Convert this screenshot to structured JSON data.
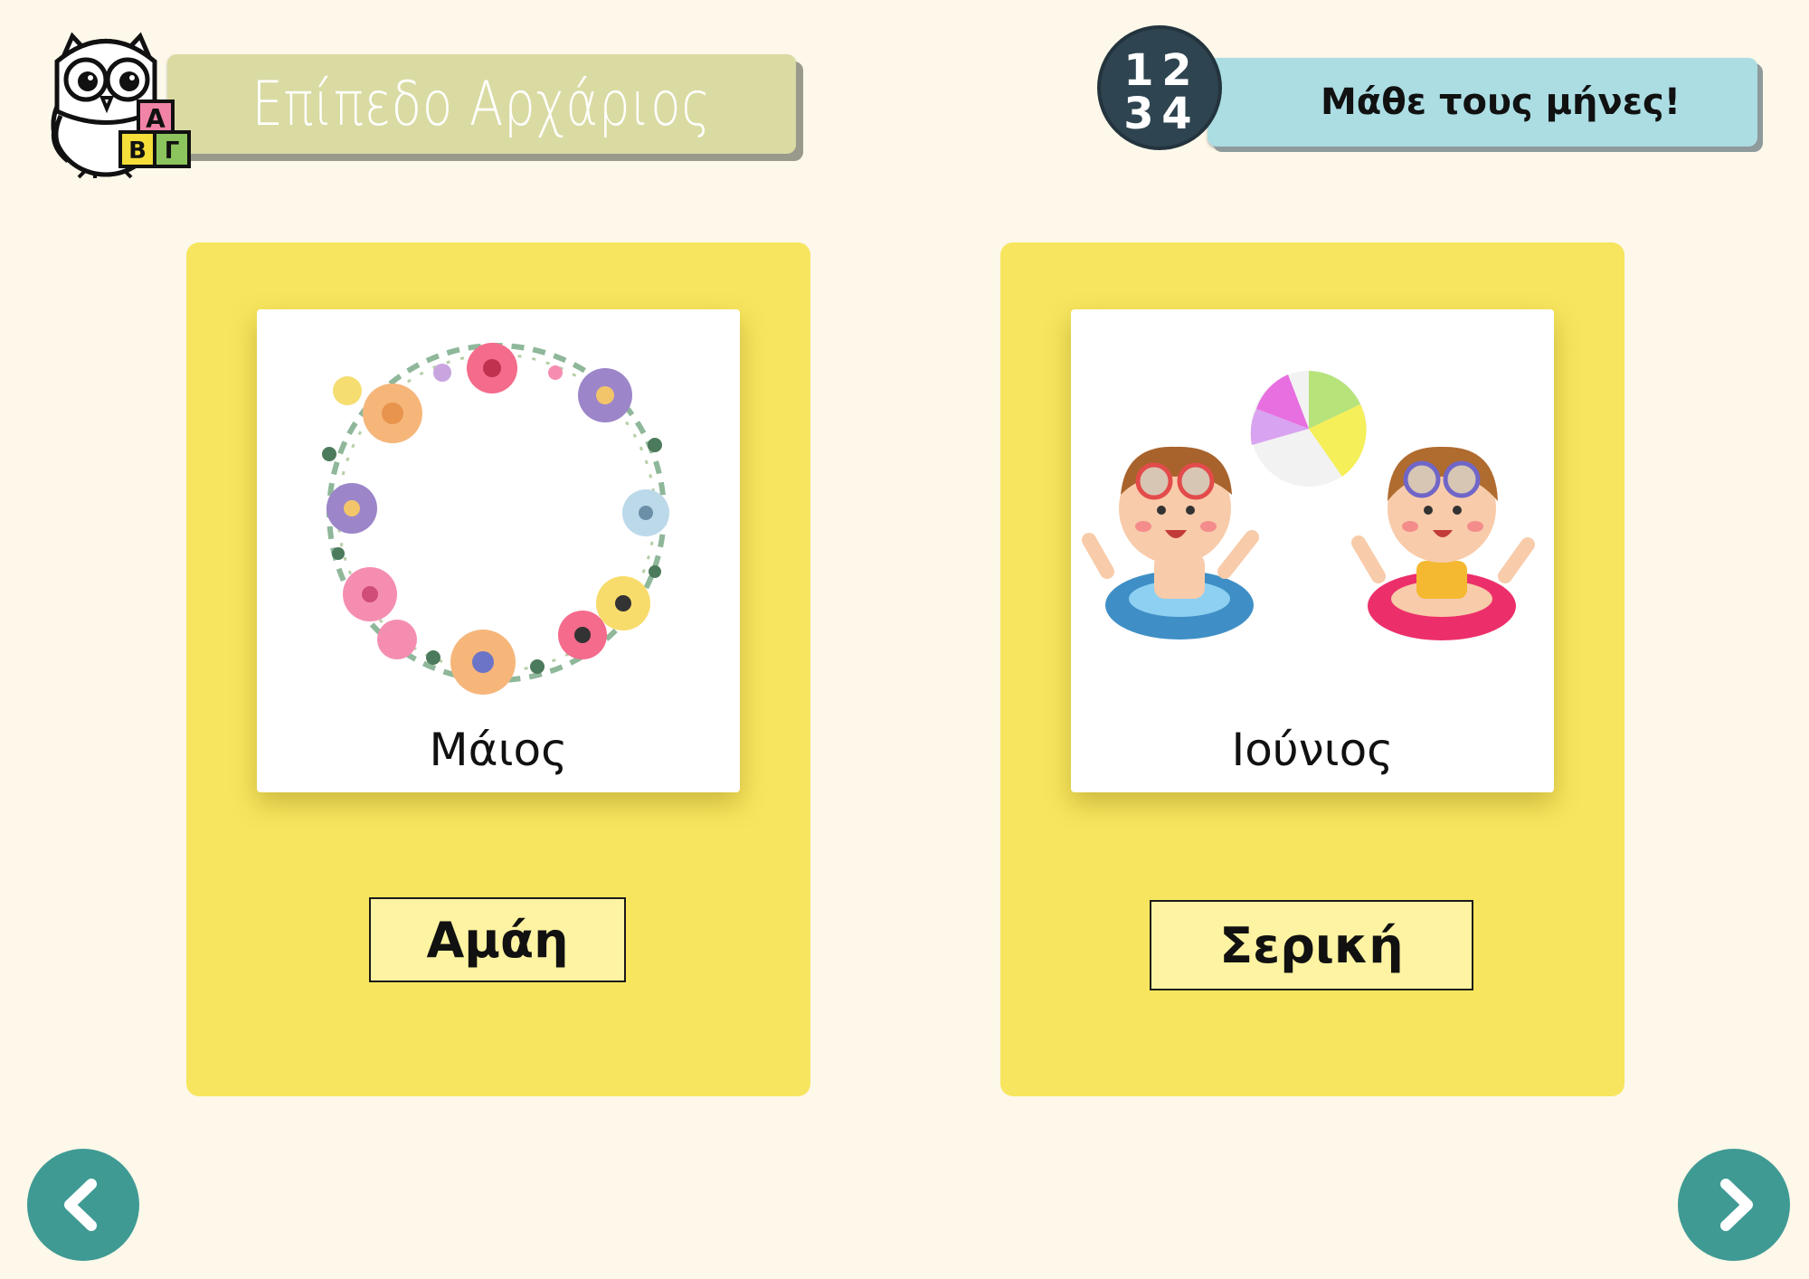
{
  "header": {
    "level_title": "Επίπεδο Αρχάριος",
    "activity_title": "Μάθε τους μήνες!",
    "numbers_badge": [
      "1",
      "2",
      "3",
      "4"
    ],
    "owl_blocks": [
      "Α",
      "Β",
      "Γ"
    ]
  },
  "cards": [
    {
      "month": "Μάιος",
      "answer": "Αμάη",
      "image": "flower-wreath"
    },
    {
      "month": "Ιούνιος",
      "answer": "Σερική",
      "image": "kids-swimming"
    }
  ],
  "navigation": {
    "prev_icon": "chevron-left-icon",
    "next_icon": "chevron-right-icon"
  },
  "colors": {
    "background": "#fdf8e9",
    "card": "#f7e55f",
    "answer_button": "#fdf3a2",
    "level_banner": "#dadba3",
    "title_banner": "#abdde3",
    "nav": "#3f9a94",
    "badge": "#2e4450"
  }
}
